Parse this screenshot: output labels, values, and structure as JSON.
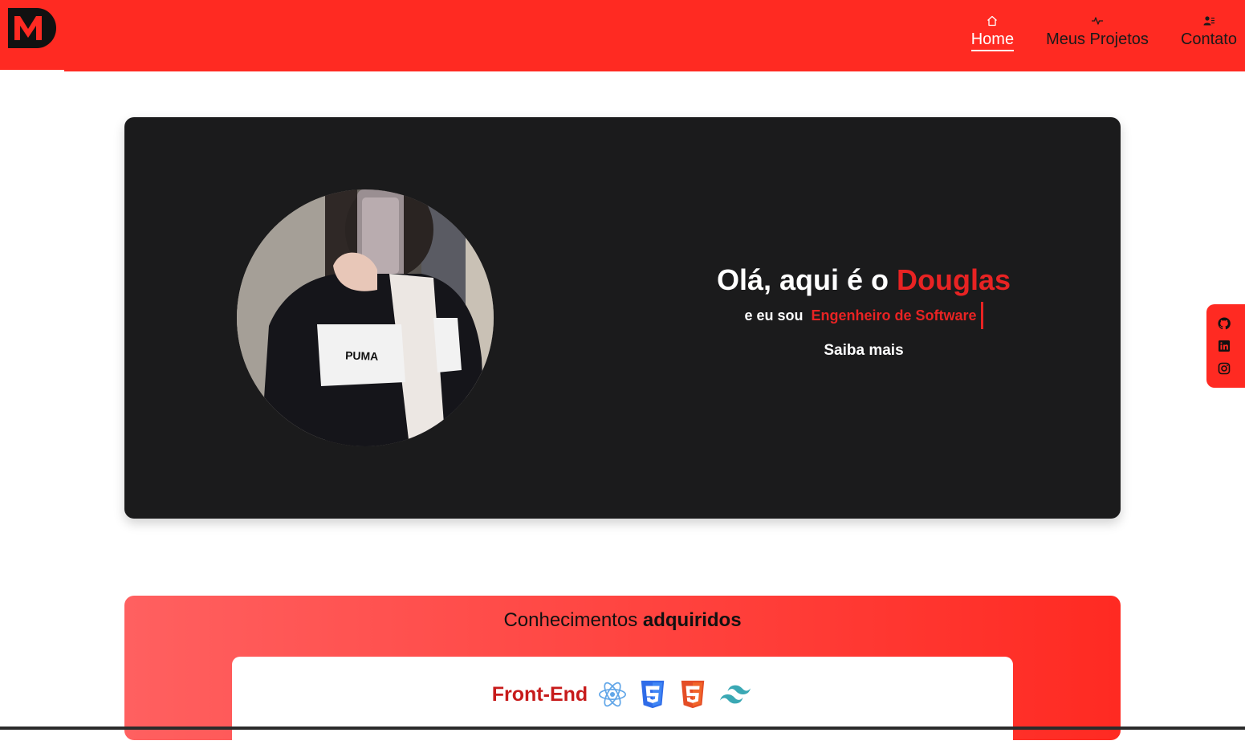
{
  "header": {
    "brand": "M",
    "nav": [
      {
        "label": "Home",
        "icon": "home-icon",
        "active": true
      },
      {
        "label": "Meus Projetos",
        "icon": "activity-icon",
        "active": false
      },
      {
        "label": "Contato",
        "icon": "contact-icon",
        "active": false
      }
    ],
    "colors": {
      "background": "#ff2a22",
      "active": "#ffffff",
      "inactive": "#1a1a1a"
    }
  },
  "hero": {
    "greeting": "Olá, aqui é o",
    "name": "Douglas",
    "subtitle_prefix": "e eu sou",
    "role": "Engenheiro de Software",
    "cta": "Saiba mais",
    "avatar_alt": "Foto de perfil",
    "colors": {
      "background": "#1b1b1c",
      "accent": "#e82323"
    }
  },
  "social": {
    "links": [
      {
        "icon": "github-icon"
      },
      {
        "icon": "linkedin-icon"
      },
      {
        "icon": "instagram-icon"
      }
    ]
  },
  "knowledge": {
    "title_regular": "Conhecimentos",
    "title_bold": "adquiridos",
    "groups": [
      {
        "label": "Front-End",
        "icons": [
          "react-icon",
          "css3-icon",
          "html5-icon",
          "tailwind-icon"
        ]
      }
    ]
  }
}
